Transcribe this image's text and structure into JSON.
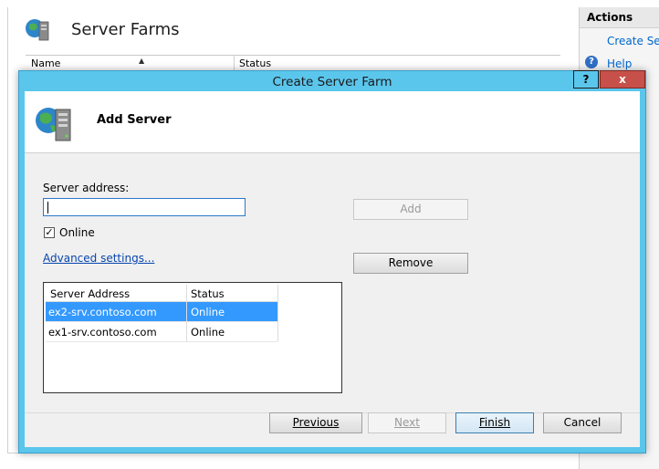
{
  "background": {
    "title": "Server Farms",
    "columns": [
      "Name",
      "Status"
    ],
    "actions": {
      "title": "Actions",
      "create_link": "Create Se",
      "help_link": "Help"
    }
  },
  "dialog": {
    "title": "Create Server Farm",
    "help_glyph": "?",
    "close_glyph": "x",
    "banner_title": "Add Server",
    "server_address_label": "Server address:",
    "server_address_value": "",
    "online_label": "Online",
    "online_checked": true,
    "advanced_link": "Advanced settings...",
    "add_button": "Add",
    "remove_button": "Remove",
    "list": {
      "headers": [
        "Server Address",
        "Status"
      ],
      "rows": [
        {
          "address": "ex2-srv.contoso.com",
          "status": "Online",
          "selected": true
        },
        {
          "address": "ex1-srv.contoso.com",
          "status": "Online",
          "selected": false
        }
      ]
    },
    "footer": {
      "previous": "Previous",
      "next": "Next",
      "finish": "Finish",
      "cancel": "Cancel"
    }
  },
  "colors": {
    "titlebar": "#5bc6ec",
    "close": "#c7504a",
    "selection": "#3399ff",
    "link": "#0645ad"
  },
  "icons": [
    "globe-server-icon",
    "help-icon",
    "close-icon",
    "check-icon"
  ]
}
